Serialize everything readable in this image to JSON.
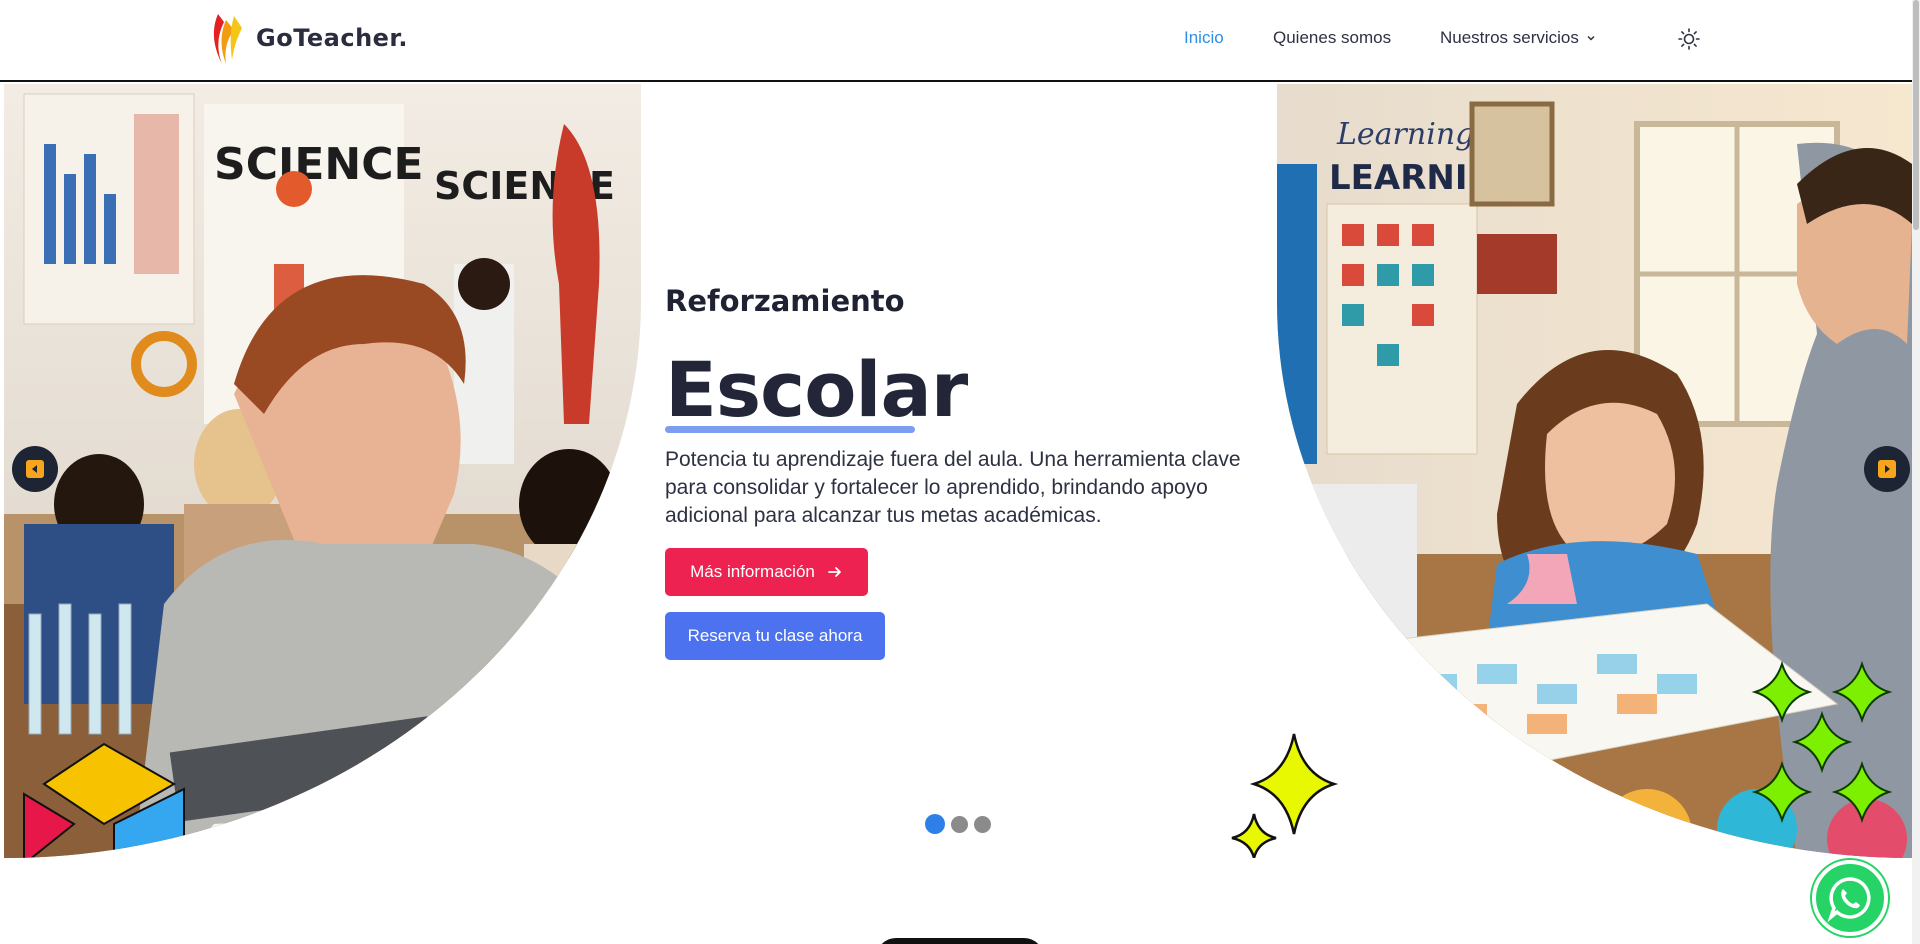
{
  "header": {
    "brand": "GoTeacher.",
    "nav": [
      {
        "label": "Inicio",
        "active": true
      },
      {
        "label": "Quienes somos",
        "active": false
      },
      {
        "label": "Nuestros servicios",
        "active": false
      }
    ],
    "theme_icon": "sun-icon"
  },
  "hero": {
    "eyebrow": "Reforzamiento",
    "title": "Escolar",
    "description": "Potencia tu aprendizaje fuera del aula. Una herramienta clave para consolidar y fortalecer lo aprendido, brindando apoyo adicional para alcanzar tus metas académicas.",
    "primary_button": "Más información",
    "secondary_button": "Reserva tu clase ahora",
    "slides_total": 3,
    "slide_active": 1,
    "left_image_words": [
      "SCIENCE",
      "SCIENCE"
    ],
    "right_image_words": [
      "Learning",
      "LEARNING"
    ]
  },
  "colors": {
    "accent_blue": "#2f8fe8",
    "button_red": "#ee2250",
    "button_blue": "#4c72f0",
    "whatsapp_green": "#25d366"
  },
  "icons": {
    "prev": "chevron-left-icon",
    "next": "chevron-right-icon",
    "arrow": "arrow-right-icon",
    "whatsapp": "whatsapp-icon"
  }
}
